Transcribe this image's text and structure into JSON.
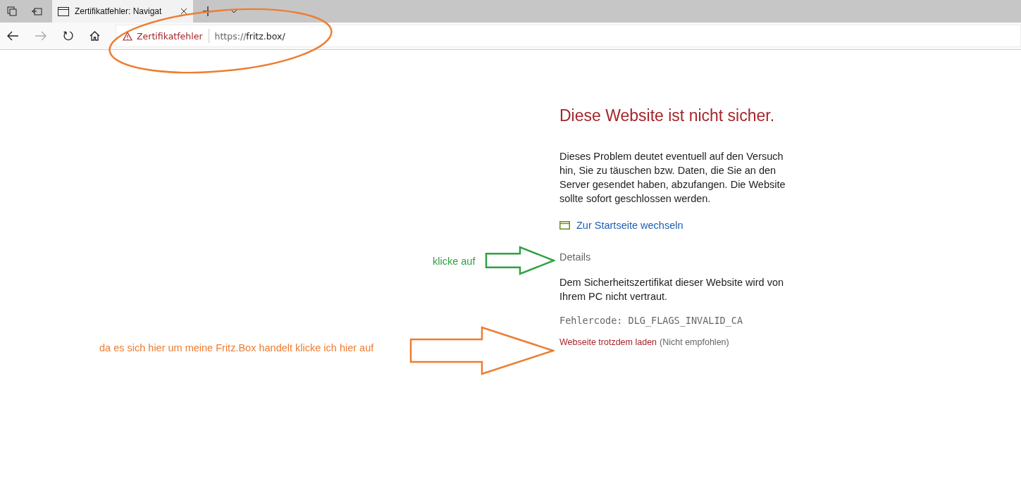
{
  "tab": {
    "title": "Zertifikatfehler: Navigat",
    "selected": true
  },
  "address_bar": {
    "warning": "Zertifikatfehler",
    "url_scheme": "https://",
    "url_host": "fritz.box/"
  },
  "page": {
    "heading": "Diese Website ist nicht sicher.",
    "description": "Dieses Problem deutet eventuell auf den Versuch hin, Sie zu täuschen bzw. Daten, die Sie an den Server gesendet haben, abzufangen. Die Website sollte sofort geschlossen werden.",
    "home_link": "Zur Startseite wechseln",
    "details": {
      "label": "Details",
      "expanded": true
    },
    "details_text": "Dem Sicherheitszertifikat dieser Website wird von Ihrem PC nicht vertraut.",
    "error_code": "Fehlercode: DLG_FLAGS_INVALID_CA",
    "proceed_link": "Webseite trotzdem laden",
    "proceed_note": "(Nicht empfohlen)"
  },
  "annotations": [
    {
      "kind": "ellipse",
      "color": "#ed7d31"
    },
    {
      "kind": "arrow",
      "text": "klicke auf",
      "color": "#2ea043"
    },
    {
      "kind": "arrow",
      "text": "da es sich hier um meine Fritz.Box handelt klicke ich hier auf",
      "color": "#ed7d31"
    }
  ]
}
